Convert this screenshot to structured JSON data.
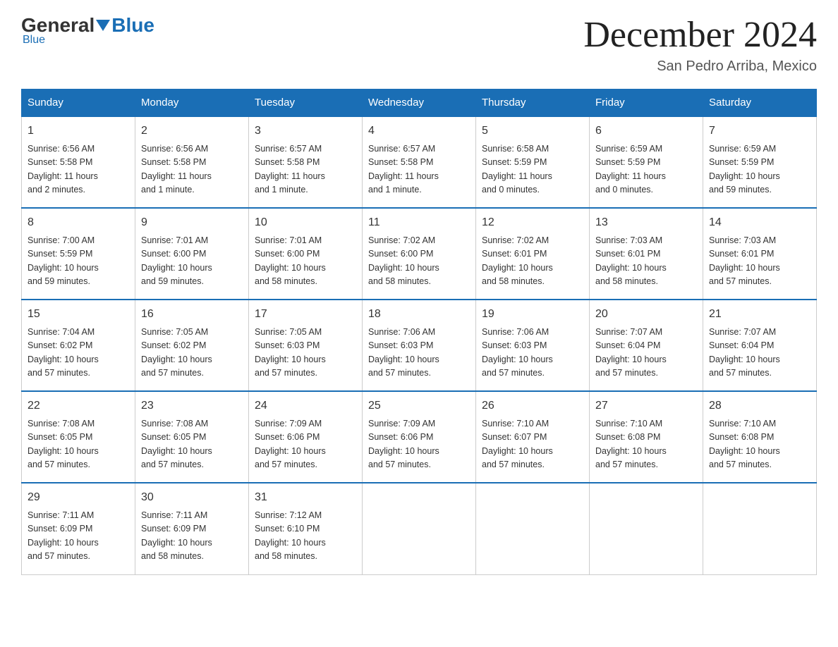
{
  "header": {
    "logo_general": "General",
    "logo_blue": "Blue",
    "month_title": "December 2024",
    "location": "San Pedro Arriba, Mexico"
  },
  "days_of_week": [
    "Sunday",
    "Monday",
    "Tuesday",
    "Wednesday",
    "Thursday",
    "Friday",
    "Saturday"
  ],
  "weeks": [
    [
      {
        "day": "1",
        "info": "Sunrise: 6:56 AM\nSunset: 5:58 PM\nDaylight: 11 hours\nand 2 minutes."
      },
      {
        "day": "2",
        "info": "Sunrise: 6:56 AM\nSunset: 5:58 PM\nDaylight: 11 hours\nand 1 minute."
      },
      {
        "day": "3",
        "info": "Sunrise: 6:57 AM\nSunset: 5:58 PM\nDaylight: 11 hours\nand 1 minute."
      },
      {
        "day": "4",
        "info": "Sunrise: 6:57 AM\nSunset: 5:58 PM\nDaylight: 11 hours\nand 1 minute."
      },
      {
        "day": "5",
        "info": "Sunrise: 6:58 AM\nSunset: 5:59 PM\nDaylight: 11 hours\nand 0 minutes."
      },
      {
        "day": "6",
        "info": "Sunrise: 6:59 AM\nSunset: 5:59 PM\nDaylight: 11 hours\nand 0 minutes."
      },
      {
        "day": "7",
        "info": "Sunrise: 6:59 AM\nSunset: 5:59 PM\nDaylight: 10 hours\nand 59 minutes."
      }
    ],
    [
      {
        "day": "8",
        "info": "Sunrise: 7:00 AM\nSunset: 5:59 PM\nDaylight: 10 hours\nand 59 minutes."
      },
      {
        "day": "9",
        "info": "Sunrise: 7:01 AM\nSunset: 6:00 PM\nDaylight: 10 hours\nand 59 minutes."
      },
      {
        "day": "10",
        "info": "Sunrise: 7:01 AM\nSunset: 6:00 PM\nDaylight: 10 hours\nand 58 minutes."
      },
      {
        "day": "11",
        "info": "Sunrise: 7:02 AM\nSunset: 6:00 PM\nDaylight: 10 hours\nand 58 minutes."
      },
      {
        "day": "12",
        "info": "Sunrise: 7:02 AM\nSunset: 6:01 PM\nDaylight: 10 hours\nand 58 minutes."
      },
      {
        "day": "13",
        "info": "Sunrise: 7:03 AM\nSunset: 6:01 PM\nDaylight: 10 hours\nand 58 minutes."
      },
      {
        "day": "14",
        "info": "Sunrise: 7:03 AM\nSunset: 6:01 PM\nDaylight: 10 hours\nand 57 minutes."
      }
    ],
    [
      {
        "day": "15",
        "info": "Sunrise: 7:04 AM\nSunset: 6:02 PM\nDaylight: 10 hours\nand 57 minutes."
      },
      {
        "day": "16",
        "info": "Sunrise: 7:05 AM\nSunset: 6:02 PM\nDaylight: 10 hours\nand 57 minutes."
      },
      {
        "day": "17",
        "info": "Sunrise: 7:05 AM\nSunset: 6:03 PM\nDaylight: 10 hours\nand 57 minutes."
      },
      {
        "day": "18",
        "info": "Sunrise: 7:06 AM\nSunset: 6:03 PM\nDaylight: 10 hours\nand 57 minutes."
      },
      {
        "day": "19",
        "info": "Sunrise: 7:06 AM\nSunset: 6:03 PM\nDaylight: 10 hours\nand 57 minutes."
      },
      {
        "day": "20",
        "info": "Sunrise: 7:07 AM\nSunset: 6:04 PM\nDaylight: 10 hours\nand 57 minutes."
      },
      {
        "day": "21",
        "info": "Sunrise: 7:07 AM\nSunset: 6:04 PM\nDaylight: 10 hours\nand 57 minutes."
      }
    ],
    [
      {
        "day": "22",
        "info": "Sunrise: 7:08 AM\nSunset: 6:05 PM\nDaylight: 10 hours\nand 57 minutes."
      },
      {
        "day": "23",
        "info": "Sunrise: 7:08 AM\nSunset: 6:05 PM\nDaylight: 10 hours\nand 57 minutes."
      },
      {
        "day": "24",
        "info": "Sunrise: 7:09 AM\nSunset: 6:06 PM\nDaylight: 10 hours\nand 57 minutes."
      },
      {
        "day": "25",
        "info": "Sunrise: 7:09 AM\nSunset: 6:06 PM\nDaylight: 10 hours\nand 57 minutes."
      },
      {
        "day": "26",
        "info": "Sunrise: 7:10 AM\nSunset: 6:07 PM\nDaylight: 10 hours\nand 57 minutes."
      },
      {
        "day": "27",
        "info": "Sunrise: 7:10 AM\nSunset: 6:08 PM\nDaylight: 10 hours\nand 57 minutes."
      },
      {
        "day": "28",
        "info": "Sunrise: 7:10 AM\nSunset: 6:08 PM\nDaylight: 10 hours\nand 57 minutes."
      }
    ],
    [
      {
        "day": "29",
        "info": "Sunrise: 7:11 AM\nSunset: 6:09 PM\nDaylight: 10 hours\nand 57 minutes."
      },
      {
        "day": "30",
        "info": "Sunrise: 7:11 AM\nSunset: 6:09 PM\nDaylight: 10 hours\nand 58 minutes."
      },
      {
        "day": "31",
        "info": "Sunrise: 7:12 AM\nSunset: 6:10 PM\nDaylight: 10 hours\nand 58 minutes."
      },
      {
        "day": "",
        "info": ""
      },
      {
        "day": "",
        "info": ""
      },
      {
        "day": "",
        "info": ""
      },
      {
        "day": "",
        "info": ""
      }
    ]
  ]
}
